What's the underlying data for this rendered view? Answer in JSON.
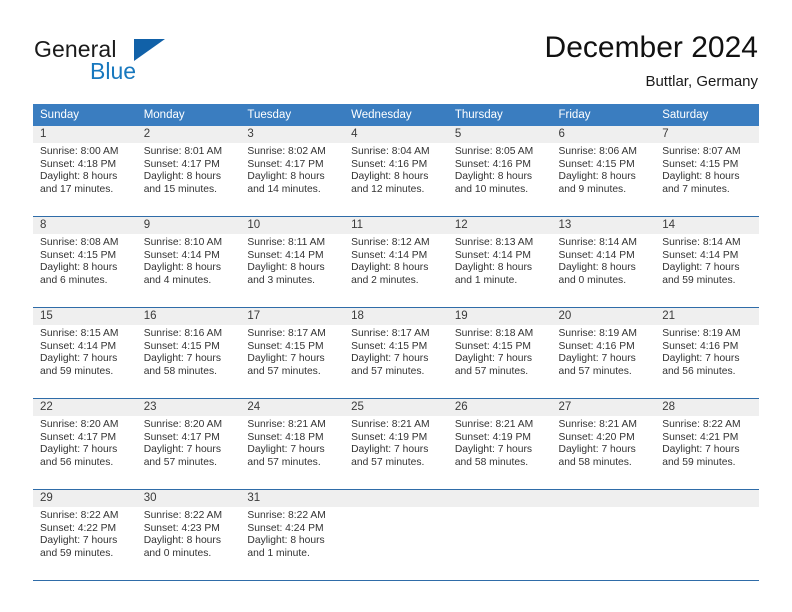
{
  "logo": {
    "word1": "General",
    "word2": "Blue",
    "flag_icon": "triangle-flag-icon"
  },
  "header": {
    "title": "December 2024",
    "location": "Buttlar, Germany"
  },
  "colors": {
    "header_blue": "#3a7dc0",
    "separator_blue": "#2f6ca8",
    "daynum_band": "#efefef",
    "logo_blue": "#1878be",
    "text": "#333333"
  },
  "weekday_headers": [
    "Sunday",
    "Monday",
    "Tuesday",
    "Wednesday",
    "Thursday",
    "Friday",
    "Saturday"
  ],
  "weeks": [
    [
      {
        "day": "1",
        "sunrise": "Sunrise: 8:00 AM",
        "sunset": "Sunset: 4:18 PM",
        "daylight1": "Daylight: 8 hours",
        "daylight2": "and 17 minutes."
      },
      {
        "day": "2",
        "sunrise": "Sunrise: 8:01 AM",
        "sunset": "Sunset: 4:17 PM",
        "daylight1": "Daylight: 8 hours",
        "daylight2": "and 15 minutes."
      },
      {
        "day": "3",
        "sunrise": "Sunrise: 8:02 AM",
        "sunset": "Sunset: 4:17 PM",
        "daylight1": "Daylight: 8 hours",
        "daylight2": "and 14 minutes."
      },
      {
        "day": "4",
        "sunrise": "Sunrise: 8:04 AM",
        "sunset": "Sunset: 4:16 PM",
        "daylight1": "Daylight: 8 hours",
        "daylight2": "and 12 minutes."
      },
      {
        "day": "5",
        "sunrise": "Sunrise: 8:05 AM",
        "sunset": "Sunset: 4:16 PM",
        "daylight1": "Daylight: 8 hours",
        "daylight2": "and 10 minutes."
      },
      {
        "day": "6",
        "sunrise": "Sunrise: 8:06 AM",
        "sunset": "Sunset: 4:15 PM",
        "daylight1": "Daylight: 8 hours",
        "daylight2": "and 9 minutes."
      },
      {
        "day": "7",
        "sunrise": "Sunrise: 8:07 AM",
        "sunset": "Sunset: 4:15 PM",
        "daylight1": "Daylight: 8 hours",
        "daylight2": "and 7 minutes."
      }
    ],
    [
      {
        "day": "8",
        "sunrise": "Sunrise: 8:08 AM",
        "sunset": "Sunset: 4:15 PM",
        "daylight1": "Daylight: 8 hours",
        "daylight2": "and 6 minutes."
      },
      {
        "day": "9",
        "sunrise": "Sunrise: 8:10 AM",
        "sunset": "Sunset: 4:14 PM",
        "daylight1": "Daylight: 8 hours",
        "daylight2": "and 4 minutes."
      },
      {
        "day": "10",
        "sunrise": "Sunrise: 8:11 AM",
        "sunset": "Sunset: 4:14 PM",
        "daylight1": "Daylight: 8 hours",
        "daylight2": "and 3 minutes."
      },
      {
        "day": "11",
        "sunrise": "Sunrise: 8:12 AM",
        "sunset": "Sunset: 4:14 PM",
        "daylight1": "Daylight: 8 hours",
        "daylight2": "and 2 minutes."
      },
      {
        "day": "12",
        "sunrise": "Sunrise: 8:13 AM",
        "sunset": "Sunset: 4:14 PM",
        "daylight1": "Daylight: 8 hours",
        "daylight2": "and 1 minute."
      },
      {
        "day": "13",
        "sunrise": "Sunrise: 8:14 AM",
        "sunset": "Sunset: 4:14 PM",
        "daylight1": "Daylight: 8 hours",
        "daylight2": "and 0 minutes."
      },
      {
        "day": "14",
        "sunrise": "Sunrise: 8:14 AM",
        "sunset": "Sunset: 4:14 PM",
        "daylight1": "Daylight: 7 hours",
        "daylight2": "and 59 minutes."
      }
    ],
    [
      {
        "day": "15",
        "sunrise": "Sunrise: 8:15 AM",
        "sunset": "Sunset: 4:14 PM",
        "daylight1": "Daylight: 7 hours",
        "daylight2": "and 59 minutes."
      },
      {
        "day": "16",
        "sunrise": "Sunrise: 8:16 AM",
        "sunset": "Sunset: 4:15 PM",
        "daylight1": "Daylight: 7 hours",
        "daylight2": "and 58 minutes."
      },
      {
        "day": "17",
        "sunrise": "Sunrise: 8:17 AM",
        "sunset": "Sunset: 4:15 PM",
        "daylight1": "Daylight: 7 hours",
        "daylight2": "and 57 minutes."
      },
      {
        "day": "18",
        "sunrise": "Sunrise: 8:17 AM",
        "sunset": "Sunset: 4:15 PM",
        "daylight1": "Daylight: 7 hours",
        "daylight2": "and 57 minutes."
      },
      {
        "day": "19",
        "sunrise": "Sunrise: 8:18 AM",
        "sunset": "Sunset: 4:15 PM",
        "daylight1": "Daylight: 7 hours",
        "daylight2": "and 57 minutes."
      },
      {
        "day": "20",
        "sunrise": "Sunrise: 8:19 AM",
        "sunset": "Sunset: 4:16 PM",
        "daylight1": "Daylight: 7 hours",
        "daylight2": "and 57 minutes."
      },
      {
        "day": "21",
        "sunrise": "Sunrise: 8:19 AM",
        "sunset": "Sunset: 4:16 PM",
        "daylight1": "Daylight: 7 hours",
        "daylight2": "and 56 minutes."
      }
    ],
    [
      {
        "day": "22",
        "sunrise": "Sunrise: 8:20 AM",
        "sunset": "Sunset: 4:17 PM",
        "daylight1": "Daylight: 7 hours",
        "daylight2": "and 56 minutes."
      },
      {
        "day": "23",
        "sunrise": "Sunrise: 8:20 AM",
        "sunset": "Sunset: 4:17 PM",
        "daylight1": "Daylight: 7 hours",
        "daylight2": "and 57 minutes."
      },
      {
        "day": "24",
        "sunrise": "Sunrise: 8:21 AM",
        "sunset": "Sunset: 4:18 PM",
        "daylight1": "Daylight: 7 hours",
        "daylight2": "and 57 minutes."
      },
      {
        "day": "25",
        "sunrise": "Sunrise: 8:21 AM",
        "sunset": "Sunset: 4:19 PM",
        "daylight1": "Daylight: 7 hours",
        "daylight2": "and 57 minutes."
      },
      {
        "day": "26",
        "sunrise": "Sunrise: 8:21 AM",
        "sunset": "Sunset: 4:19 PM",
        "daylight1": "Daylight: 7 hours",
        "daylight2": "and 58 minutes."
      },
      {
        "day": "27",
        "sunrise": "Sunrise: 8:21 AM",
        "sunset": "Sunset: 4:20 PM",
        "daylight1": "Daylight: 7 hours",
        "daylight2": "and 58 minutes."
      },
      {
        "day": "28",
        "sunrise": "Sunrise: 8:22 AM",
        "sunset": "Sunset: 4:21 PM",
        "daylight1": "Daylight: 7 hours",
        "daylight2": "and 59 minutes."
      }
    ],
    [
      {
        "day": "29",
        "sunrise": "Sunrise: 8:22 AM",
        "sunset": "Sunset: 4:22 PM",
        "daylight1": "Daylight: 7 hours",
        "daylight2": "and 59 minutes."
      },
      {
        "day": "30",
        "sunrise": "Sunrise: 8:22 AM",
        "sunset": "Sunset: 4:23 PM",
        "daylight1": "Daylight: 8 hours",
        "daylight2": "and 0 minutes."
      },
      {
        "day": "31",
        "sunrise": "Sunrise: 8:22 AM",
        "sunset": "Sunset: 4:24 PM",
        "daylight1": "Daylight: 8 hours",
        "daylight2": "and 1 minute."
      },
      {
        "day": "",
        "sunrise": "",
        "sunset": "",
        "daylight1": "",
        "daylight2": ""
      },
      {
        "day": "",
        "sunrise": "",
        "sunset": "",
        "daylight1": "",
        "daylight2": ""
      },
      {
        "day": "",
        "sunrise": "",
        "sunset": "",
        "daylight1": "",
        "daylight2": ""
      },
      {
        "day": "",
        "sunrise": "",
        "sunset": "",
        "daylight1": "",
        "daylight2": ""
      }
    ]
  ]
}
